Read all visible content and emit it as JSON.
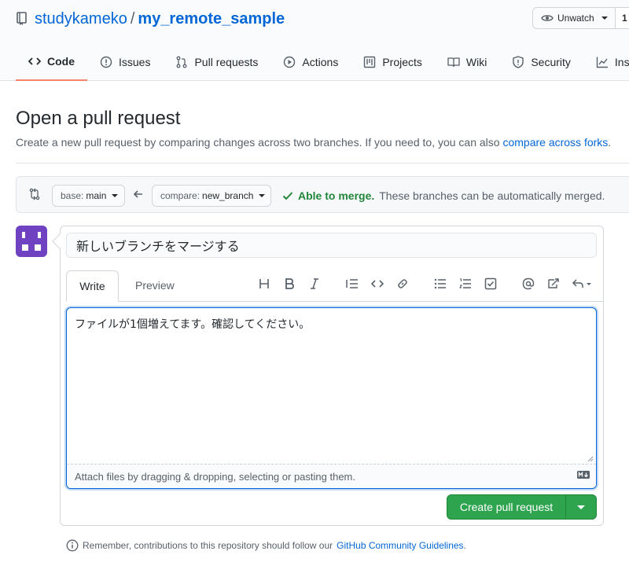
{
  "colors": {
    "link": "#0366d6",
    "success": "#2ea44f",
    "merge_ok": "#22863a",
    "tab_underline": "#f9826c",
    "avatar_purple": "#6f42c1"
  },
  "repo": {
    "owner": "studykameko",
    "separator": "/",
    "name": "my_remote_sample",
    "icon": "repo-icon"
  },
  "header_actions": {
    "watch_label": "Unwatch",
    "watch_count": "1"
  },
  "nav_tabs": [
    {
      "label": "Code",
      "icon": "code-icon",
      "selected": true
    },
    {
      "label": "Issues",
      "icon": "issue-icon"
    },
    {
      "label": "Pull requests",
      "icon": "git-pull-request-icon"
    },
    {
      "label": "Actions",
      "icon": "play-icon"
    },
    {
      "label": "Projects",
      "icon": "project-icon"
    },
    {
      "label": "Wiki",
      "icon": "book-icon"
    },
    {
      "label": "Security",
      "icon": "shield-icon"
    },
    {
      "label": "Insigh",
      "icon": "graph-icon"
    }
  ],
  "page": {
    "title": "Open a pull request",
    "subtitle": "Create a new pull request by comparing changes across two branches. If you need to, you can also",
    "compare_forks_link": "compare across forks",
    "subtitle_end": "."
  },
  "range": {
    "base_prefix": "base:",
    "base_branch": "main",
    "compare_prefix": "compare:",
    "compare_branch": "new_branch",
    "merge_ok": "Able to merge.",
    "merge_detail": "These branches can be automatically merged."
  },
  "form": {
    "title_value": "新しいブランチをマージする",
    "write_tab": "Write",
    "preview_tab": "Preview",
    "body_value": "ファイルが1個増えてます。確認してください。",
    "attach_hint": "Attach files by dragging & dropping, selecting or pasting them.",
    "toolbar_icons": [
      "heading-icon",
      "bold-icon",
      "italic-icon",
      "quote-icon",
      "code-icon",
      "link-icon",
      "bullet-list-icon",
      "numbered-list-icon",
      "task-list-icon",
      "mention-icon",
      "cross-reference-icon",
      "reply-icon"
    ],
    "submit_label": "Create pull request"
  },
  "footer": {
    "note": "Remember, contributions to this repository should follow our",
    "guidelines_link": "GitHub Community Guidelines",
    "note_end": "."
  }
}
